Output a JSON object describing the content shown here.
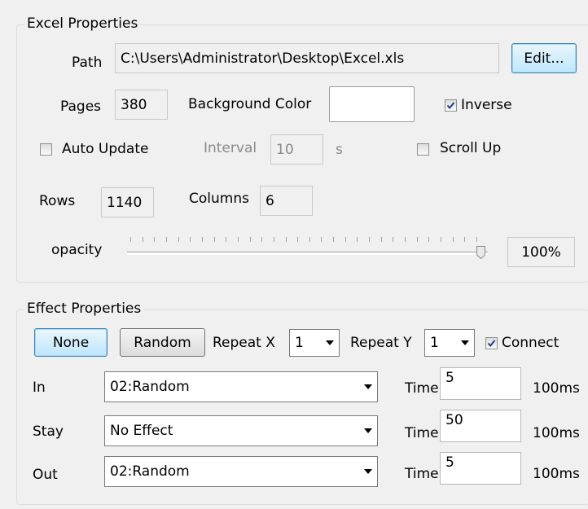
{
  "excel": {
    "title": "Excel Properties",
    "path_label": "Path",
    "path_value": "C:\\Users\\Administrator\\Desktop\\Excel.xls",
    "edit_button": "Edit...",
    "pages_label": "Pages",
    "pages_value": "380",
    "bg_color_label": "Background Color",
    "bg_color_value": "#ffffff",
    "inverse_label": "Inverse",
    "inverse_checked": true,
    "auto_update_label": "Auto Update",
    "auto_update_checked": false,
    "interval_label": "Interval",
    "interval_value": "10",
    "interval_unit": "s",
    "scroll_up_label": "Scroll Up",
    "scroll_up_checked": false,
    "rows_label": "Rows",
    "rows_value": "1140",
    "columns_label": "Columns",
    "columns_value": "6",
    "opacity_label": "opacity",
    "opacity_value": "100%",
    "opacity_level": 1.0
  },
  "effect": {
    "title": "Effect Properties",
    "none_button": "None",
    "random_button": "Random",
    "repeat_x_label": "Repeat X",
    "repeat_x_value": "1",
    "repeat_y_label": "Repeat Y",
    "repeat_y_value": "1",
    "connect_label": "Connect",
    "connect_checked": true,
    "rows": [
      {
        "label": "In",
        "effect": "02:Random",
        "time_label": "Time",
        "time_value": "5",
        "unit": "100ms"
      },
      {
        "label": "Stay",
        "effect": "No Effect",
        "time_label": "Time",
        "time_value": "50",
        "unit": "100ms"
      },
      {
        "label": "Out",
        "effect": "02:Random",
        "time_label": "Time",
        "time_value": "5",
        "unit": "100ms"
      }
    ]
  }
}
